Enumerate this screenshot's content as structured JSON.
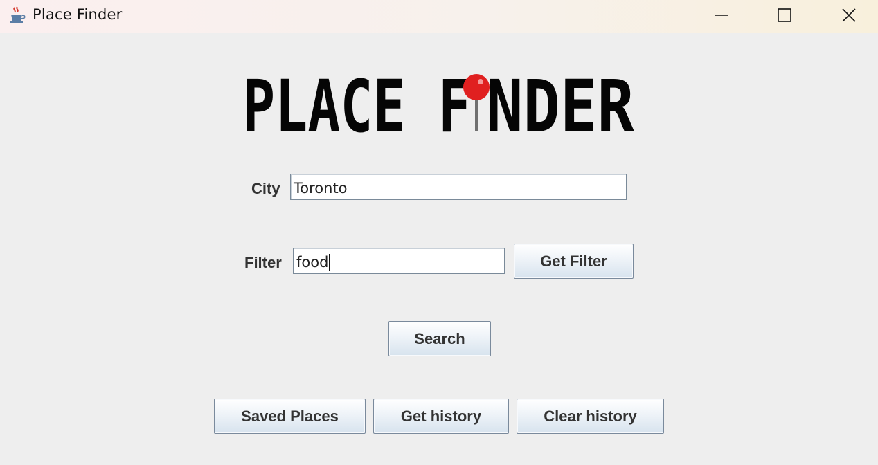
{
  "window": {
    "title": "Place Finder",
    "app_icon": "java-coffee-cup-icon"
  },
  "logo": {
    "text_left": "PLACE F",
    "text_right": "NDER",
    "pin_icon": "map-pin-icon",
    "pin_color": "#e02020"
  },
  "city": {
    "label": "City",
    "value": "Toronto"
  },
  "filter": {
    "label": "Filter",
    "value": "food",
    "button_label": "Get Filter"
  },
  "search": {
    "button_label": "Search"
  },
  "bottom_buttons": {
    "saved_places": "Saved Places",
    "get_history": "Get history",
    "clear_history": "Clear history"
  },
  "colors": {
    "background": "#eeeeee",
    "button_gradient_bottom": "#d7e3ee",
    "text": "#333333"
  }
}
